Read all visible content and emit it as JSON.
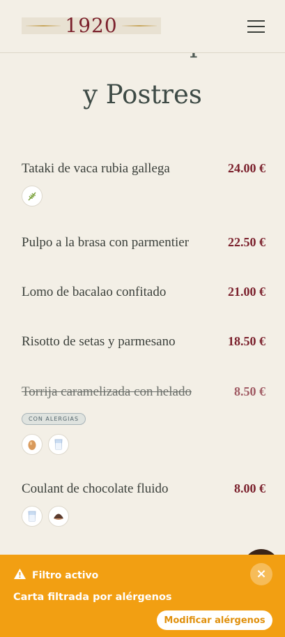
{
  "header": {
    "logo_text": "1920",
    "menu_icon": "hamburger-icon"
  },
  "section": {
    "title_cut": "Platos Principales",
    "title": "y Postres"
  },
  "dishes": [
    {
      "name": "Tataki de vaca rubia gallega",
      "price": "24.00 €",
      "struck": false,
      "badge": "",
      "allergens": [
        "mustard-icon"
      ]
    },
    {
      "name": "Pulpo a la brasa con parmentier",
      "price": "22.50 €",
      "struck": false,
      "badge": "",
      "allergens": []
    },
    {
      "name": "Lomo de bacalao confitado",
      "price": "21.00 €",
      "struck": false,
      "badge": "",
      "allergens": []
    },
    {
      "name": "Risotto de setas y parmesano",
      "price": "18.50 €",
      "struck": false,
      "badge": "",
      "allergens": []
    },
    {
      "name": "Torrija caramelizada con helado",
      "price": "8.50 €",
      "struck": true,
      "badge": "CON ALERGIAS",
      "allergens": [
        "egg-icon",
        "milk-icon"
      ]
    },
    {
      "name": "Coulant de chocolate fluido",
      "price": "8.00 €",
      "struck": false,
      "badge": "",
      "allergens": [
        "milk-icon",
        "nuts-icon"
      ]
    }
  ],
  "filter": {
    "title": "Filtro activo",
    "description": "Carta filtrada por alérgenos",
    "modify_label": "Modificar alérgenos",
    "close_label": "×"
  },
  "colors": {
    "accent": "#7a1f2b",
    "warning": "#f29f12",
    "background": "#f3efe6"
  }
}
